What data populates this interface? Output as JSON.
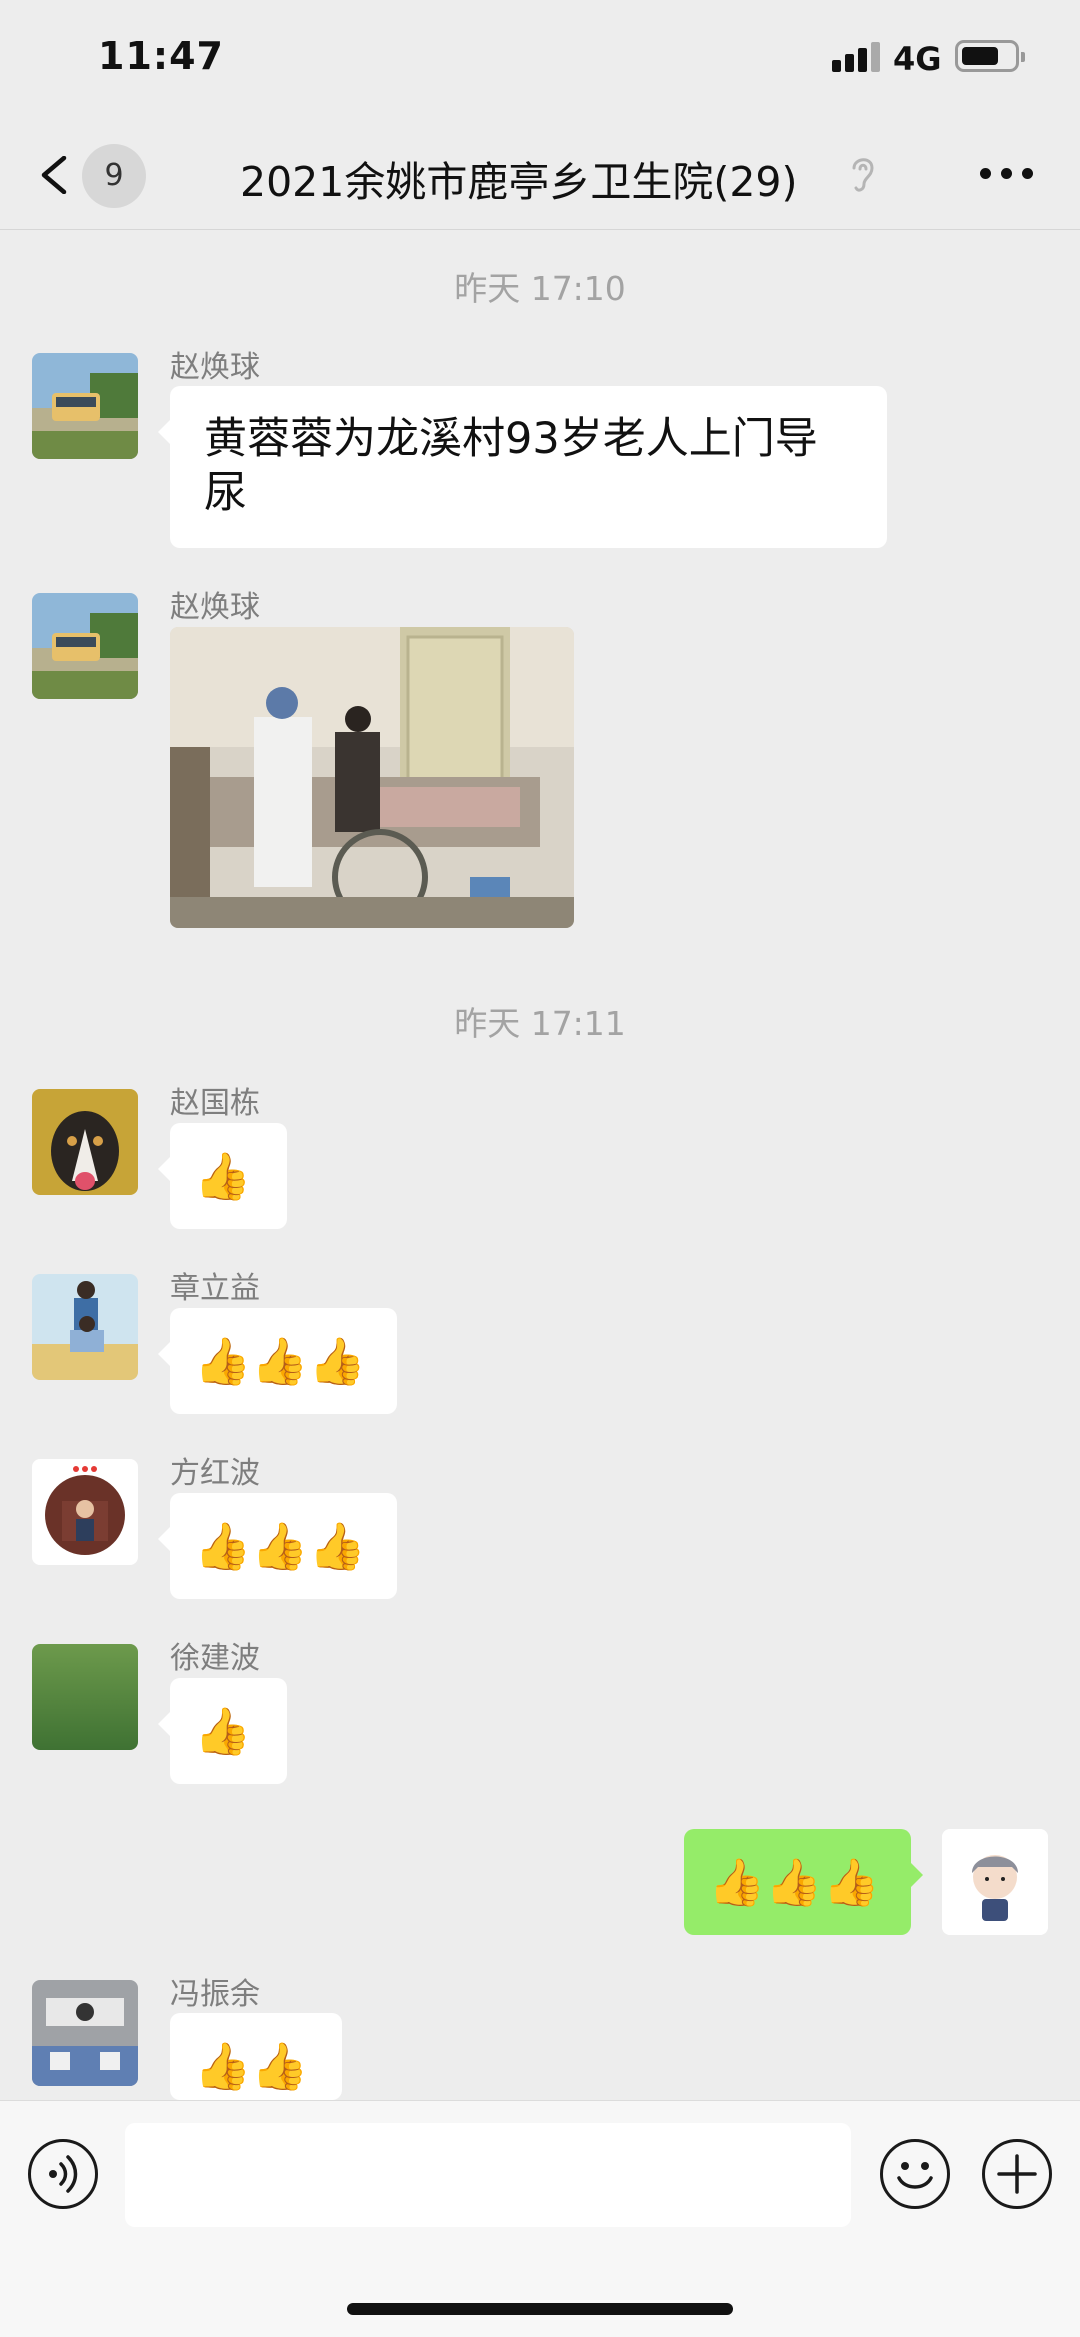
{
  "status_bar": {
    "time": "11:47",
    "network": "4G"
  },
  "header": {
    "unread_count": "9",
    "title": "2021余姚市鹿亭乡卫生院(29)"
  },
  "messages": [
    {
      "type": "timestamp",
      "text": "昨天 17:10"
    },
    {
      "type": "text",
      "sender": "赵焕球",
      "text": "黄蓉蓉为龙溪村93岁老人上门导尿"
    },
    {
      "type": "image",
      "sender": "赵焕球"
    },
    {
      "type": "timestamp",
      "text": "昨天 17:11"
    },
    {
      "type": "emoji",
      "sender": "赵国栋",
      "text": "👍"
    },
    {
      "type": "emoji",
      "sender": "章立益",
      "text": "👍👍👍"
    },
    {
      "type": "emoji",
      "sender": "方红波",
      "text": "👍👍👍"
    },
    {
      "type": "emoji",
      "sender": "徐建波",
      "text": "👍"
    },
    {
      "type": "emoji",
      "sender": "me",
      "text": "👍👍👍"
    },
    {
      "type": "emoji",
      "sender": "冯振余",
      "text": "👍👍"
    }
  ],
  "input": {
    "placeholder": ""
  },
  "colors": {
    "background": "#ededed",
    "own_bubble": "#95ec69",
    "other_bubble": "#ffffff"
  }
}
